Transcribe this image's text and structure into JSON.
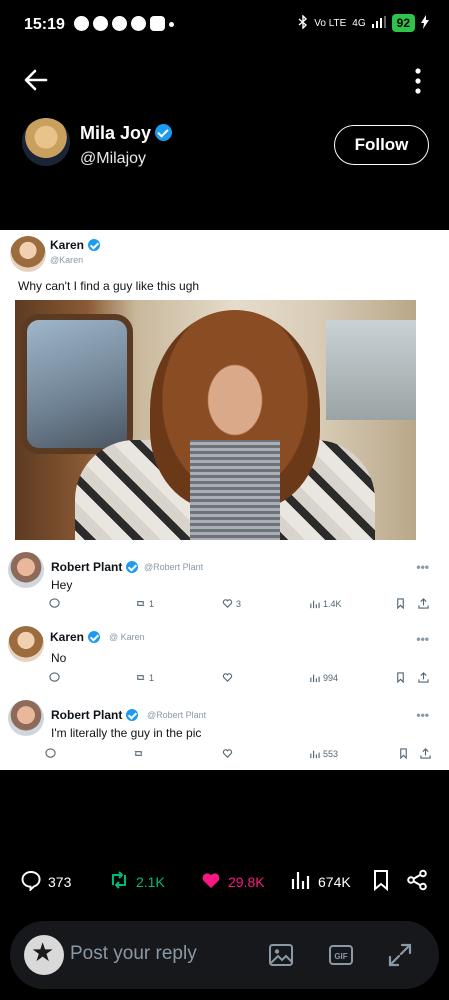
{
  "status_bar": {
    "time": "15:19",
    "network": "Vo LTE",
    "signal": "4G",
    "battery": "92"
  },
  "post": {
    "author_name": "Mila Joy",
    "author_handle": "@Milajoy",
    "follow_label": "Follow"
  },
  "embedded": {
    "tweets": [
      {
        "name": "Karen",
        "handle": "@Karen",
        "text": "Why can't I find a guy like this ugh"
      },
      {
        "name": "Robert Plant",
        "handle": "@Robert Plant",
        "text": "Hey",
        "retweets": "1",
        "likes": "3",
        "views": "1.4K"
      },
      {
        "name": "Karen",
        "handle": "@ Karen",
        "text": "No",
        "retweets": "1",
        "views": "994"
      },
      {
        "name": "Robert Plant",
        "handle": "@Robert Plant",
        "text": "I'm literally the guy in the pic",
        "views": "553"
      }
    ],
    "more_glyph": "•••"
  },
  "stats": {
    "replies": "373",
    "reposts": "2.1K",
    "likes": "29.8K",
    "views": "674K"
  },
  "reply": {
    "placeholder": "Post your reply"
  },
  "colors": {
    "repost": "#00ba7c",
    "like": "#f91880",
    "verified": "#1d9bf0"
  }
}
